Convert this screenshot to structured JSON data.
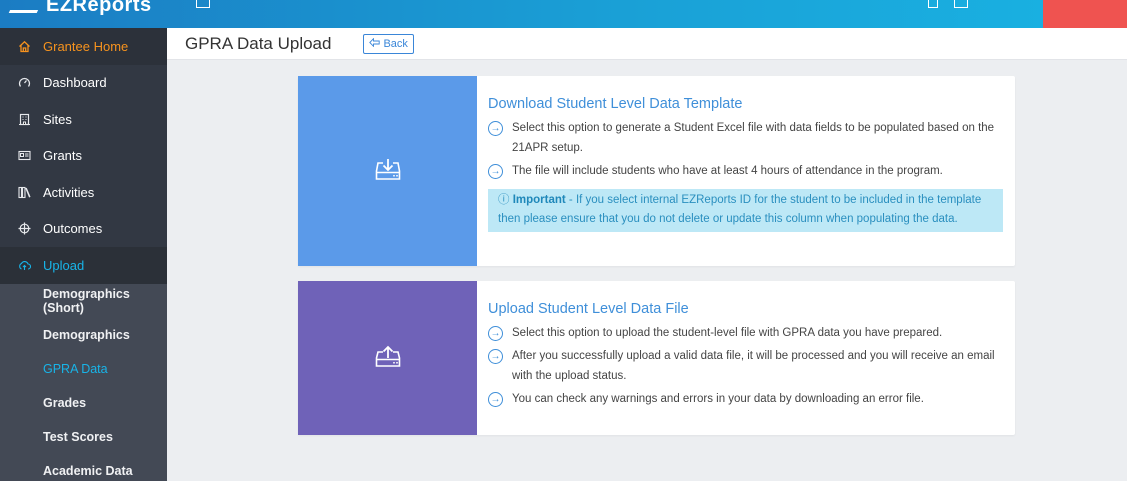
{
  "app": {
    "brand": "EZReports"
  },
  "sidebar": {
    "items": [
      {
        "label": "Grantee Home",
        "icon": "home-icon"
      },
      {
        "label": "Dashboard",
        "icon": "gauge-icon"
      },
      {
        "label": "Sites",
        "icon": "building-icon"
      },
      {
        "label": "Grants",
        "icon": "id-card-icon"
      },
      {
        "label": "Activities",
        "icon": "books-icon"
      },
      {
        "label": "Outcomes",
        "icon": "crosshair-icon"
      },
      {
        "label": "Upload",
        "icon": "cloud-upload-icon"
      }
    ],
    "upload_sub": [
      {
        "label": "Demographics (Short)"
      },
      {
        "label": "Demographics"
      },
      {
        "label": "GPRA Data"
      },
      {
        "label": "Grades"
      },
      {
        "label": "Test Scores"
      },
      {
        "label": "Academic Data"
      }
    ]
  },
  "header": {
    "title": "GPRA Data Upload",
    "back_label": "Back"
  },
  "cards": {
    "download": {
      "title": "Download Student Level Data Template",
      "bullets": [
        "Select this option to generate a Student Excel file with data fields to be populated based on the 21APR setup.",
        "The file will include students who have at least 4 hours of attendance in the program."
      ],
      "important_label": "Important",
      "important_text": " - If you select internal EZReports ID for the student to be included in the template then please ensure that you do not delete or update this column when populating the data."
    },
    "upload": {
      "title": "Upload Student Level Data File",
      "bullets": [
        "Select this option to upload the student-level file with GPRA data you have prepared.",
        "After you successfully upload a valid data file, it will be processed and you will receive an email with the upload status.",
        "You can check any warnings and errors in your data by downloading an error file."
      ]
    }
  },
  "colors": {
    "accent": "#3f8fd9",
    "home_active": "#f7931e",
    "upload_active": "#18b4e8",
    "download_panel": "#5b9ae9",
    "upload_panel": "#6f62b8"
  }
}
